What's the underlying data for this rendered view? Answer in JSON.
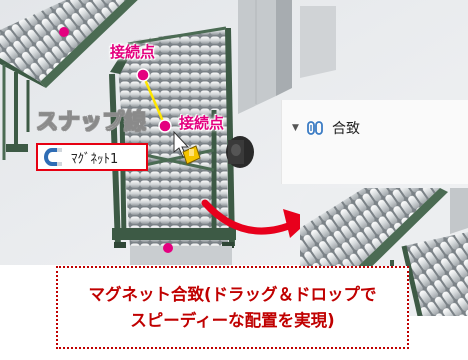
{
  "viewport": {
    "connection_point_labels": [
      "接続点",
      "接続点"
    ],
    "snap_line_label": "スナップ線"
  },
  "feature_tree": {
    "mates_folder_label": "合致",
    "magnet_mate_label": "ﾏｸﾞﾈｯﾄ1",
    "expand_icon": "chevron-down-icon",
    "mates_icon": "mate-paperclip-icon",
    "magnet_icon": "magnet-icon"
  },
  "caption": {
    "line1": "マグネット合致(ドラッグ＆ドロップで",
    "line2": "スピーディーな配置を実現)"
  },
  "colors": {
    "label_magenta": "#e4007f",
    "highlight_red": "#e60012",
    "caption_red": "#c00000",
    "arrow_red": "#e8001c",
    "frame_green": "#3d5a45"
  }
}
